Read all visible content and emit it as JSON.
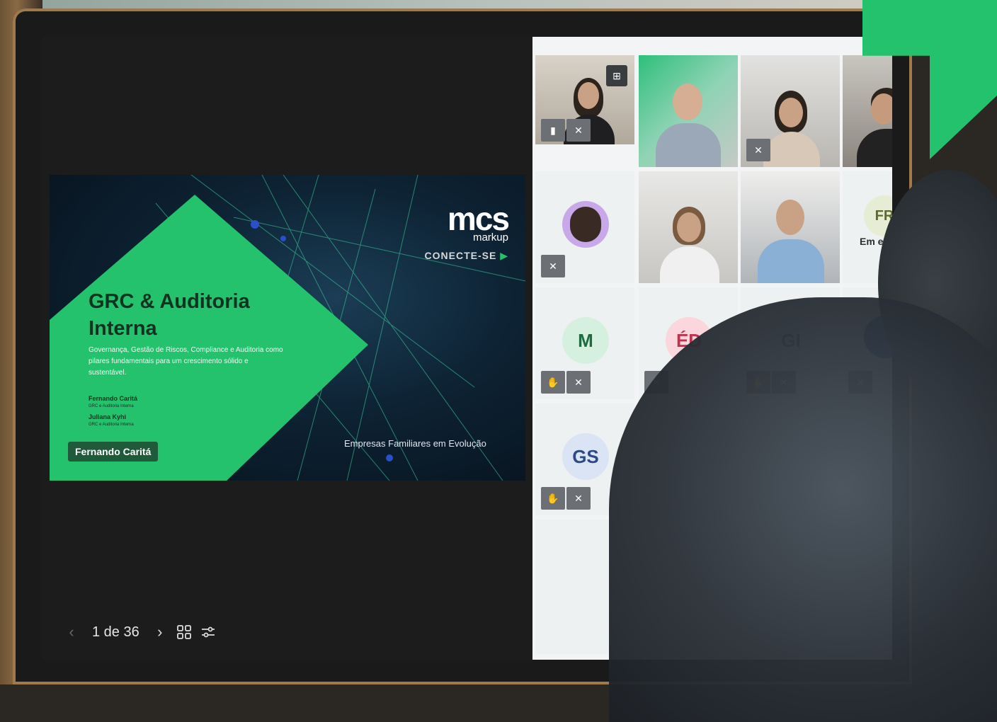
{
  "slide": {
    "title_line1": "GRC & Auditoria",
    "title_line2": "Interna",
    "subtitle": "Governança, Gestão de Riscos, Compliance e Auditoria como pilares fundamentais para um crescimento sólido e sustentável.",
    "presenter1_name": "Fernando Caritá",
    "presenter1_role": "GRC e Auditoria Interna",
    "presenter2_name": "Juliana Kyhi",
    "presenter2_role": "GRC e Auditoria Interna",
    "logo_main": "mcs",
    "logo_small": "markup",
    "logo_cta": "CONECTE-SE",
    "footer": "Empresas Familiares em Evolução",
    "speaker_tag": "Fernando Caritá",
    "accent_color": "#25c26e"
  },
  "pager": {
    "prev_icon": "chevron-left",
    "current": "1 de 36",
    "next_icon": "chevron-right",
    "grid_icon": "grid",
    "settings_icon": "sliders"
  },
  "gallery": {
    "tiles": [
      {
        "type": "video",
        "label": ""
      },
      {
        "type": "video",
        "label": ""
      },
      {
        "type": "video",
        "label": ""
      },
      {
        "type": "video",
        "label": ""
      },
      {
        "type": "photo",
        "label": ""
      },
      {
        "type": "video",
        "label": ""
      },
      {
        "type": "video",
        "label": ""
      },
      {
        "type": "initials",
        "initials": "FR",
        "status": "Em espera"
      },
      {
        "type": "initials",
        "initials": "M"
      },
      {
        "type": "initials",
        "initials": "ÉD"
      },
      {
        "type": "initials",
        "initials": "GI"
      },
      {
        "type": "photo",
        "label": ""
      },
      {
        "type": "initials",
        "initials": "GS"
      }
    ]
  }
}
